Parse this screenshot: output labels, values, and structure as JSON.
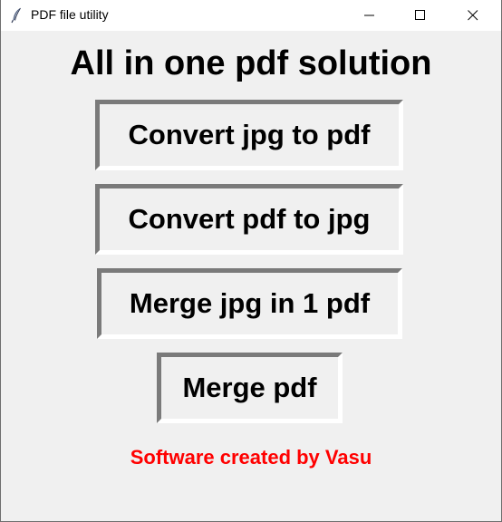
{
  "window": {
    "title": "PDF file utility",
    "icon": "feather-icon",
    "controls": {
      "minimize": "minimize-icon",
      "maximize": "maximize-icon",
      "close": "close-icon"
    }
  },
  "main": {
    "heading": "All in one pdf solution",
    "buttons": [
      {
        "label": "Convert jpg to pdf"
      },
      {
        "label": "Convert pdf to jpg"
      },
      {
        "label": "Merge jpg in 1 pdf"
      },
      {
        "label": "Merge pdf"
      }
    ],
    "credit": "Software created by Vasu"
  },
  "colors": {
    "background": "#f0f0f0",
    "titlebar": "#ffffff",
    "credit_text": "#ff0000",
    "button_shadow": "#7a7a7a"
  }
}
